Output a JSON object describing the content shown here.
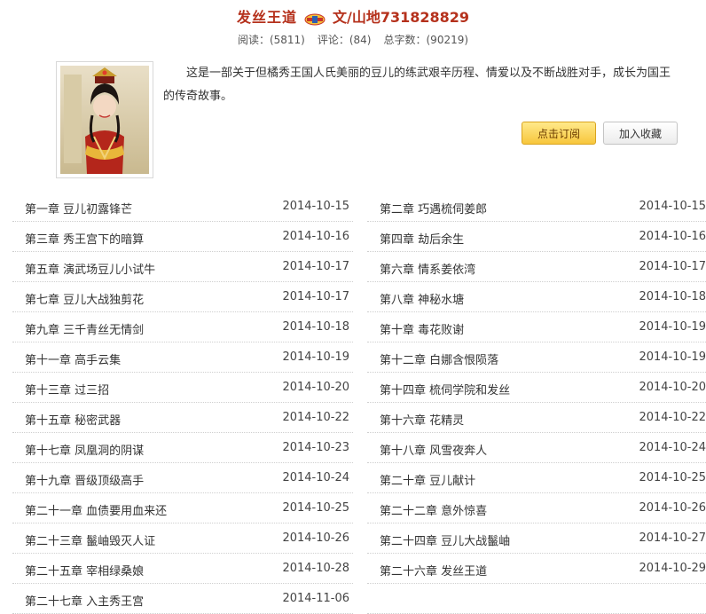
{
  "book": {
    "title": "发丝王道",
    "author_label": "文/山地731828829",
    "stats": {
      "reads": "阅读：(5811)",
      "comments": "评论：(84)",
      "words": "总字数：(90219)"
    },
    "description": "这是一部关于但橘秀王国人氏美丽的豆儿的练武艰辛历程、情爱以及不断战胜对手，成长为国王的传奇故事。",
    "subscribe_label": "点击订阅",
    "collect_label": "加入收藏",
    "badge_icon": "vip-badge-icon",
    "accent_color": "#b5311c"
  },
  "chapters": [
    {
      "left": {
        "title": "第一章 豆儿初露锋芒",
        "date": "2014-10-15"
      },
      "right": {
        "title": "第二章 巧遇梳伺姜郎",
        "date": "2014-10-15"
      }
    },
    {
      "left": {
        "title": "第三章 秀王宫下的暗算",
        "date": "2014-10-16"
      },
      "right": {
        "title": "第四章 劫后余生",
        "date": "2014-10-16"
      }
    },
    {
      "left": {
        "title": "第五章 演武场豆儿小试牛",
        "date": "2014-10-17"
      },
      "right": {
        "title": "第六章 情系姜依湾",
        "date": "2014-10-17"
      }
    },
    {
      "left": {
        "title": "第七章 豆儿大战独剪花",
        "date": "2014-10-17"
      },
      "right": {
        "title": "第八章 神秘水塘",
        "date": "2014-10-18"
      }
    },
    {
      "left": {
        "title": "第九章 三千青丝无情剑",
        "date": "2014-10-18"
      },
      "right": {
        "title": "第十章 毒花败谢",
        "date": "2014-10-19"
      }
    },
    {
      "left": {
        "title": "第十一章 高手云集",
        "date": "2014-10-19"
      },
      "right": {
        "title": "第十二章 白娜含恨陨落",
        "date": "2014-10-19"
      }
    },
    {
      "left": {
        "title": "第十三章 过三招",
        "date": "2014-10-20"
      },
      "right": {
        "title": "第十四章 梳伺学院和发丝",
        "date": "2014-10-20"
      }
    },
    {
      "left": {
        "title": "第十五章 秘密武器",
        "date": "2014-10-22"
      },
      "right": {
        "title": "第十六章 花精灵",
        "date": "2014-10-22"
      }
    },
    {
      "left": {
        "title": "第十七章 凤凰洞的阴谋",
        "date": "2014-10-23"
      },
      "right": {
        "title": "第十八章 风雪夜奔人",
        "date": "2014-10-24"
      }
    },
    {
      "left": {
        "title": "第十九章 晋级顶级高手",
        "date": "2014-10-24"
      },
      "right": {
        "title": "第二十章 豆儿献计",
        "date": "2014-10-25"
      }
    },
    {
      "left": {
        "title": "第二十一章 血债要用血来还",
        "date": "2014-10-25"
      },
      "right": {
        "title": "第二十二章 意外惊喜",
        "date": "2014-10-26"
      }
    },
    {
      "left": {
        "title": "第二十三章 鬣岫毁灭人证",
        "date": "2014-10-26"
      },
      "right": {
        "title": "第二十四章 豆儿大战鬣岫",
        "date": "2014-10-27"
      }
    },
    {
      "left": {
        "title": "第二十五章 宰相绿桑娘",
        "date": "2014-10-28"
      },
      "right": {
        "title": "第二十六章 发丝王道",
        "date": "2014-10-29"
      }
    },
    {
      "left": {
        "title": "第二十七章 入主秀王宫",
        "date": "2014-11-06"
      },
      "right": null
    }
  ]
}
